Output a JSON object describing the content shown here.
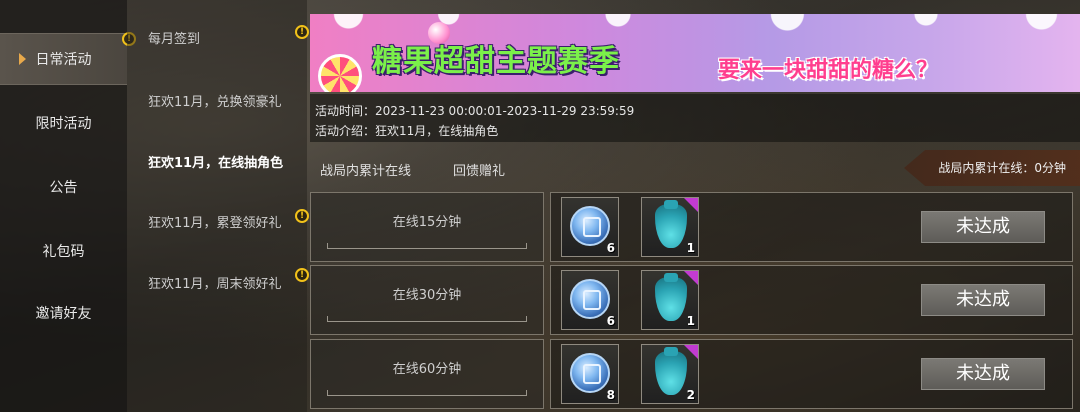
{
  "nav": {
    "items": [
      {
        "label": "日常活动",
        "active": true
      },
      {
        "label": "限时活动",
        "active": false
      },
      {
        "label": "公告",
        "active": false
      },
      {
        "label": "礼包码",
        "active": false
      },
      {
        "label": "邀请好友",
        "active": false
      }
    ]
  },
  "sublist": {
    "items": [
      {
        "label": "每月签到",
        "active": false,
        "alert": true
      },
      {
        "label": "狂欢11月，兑换领豪礼",
        "active": false,
        "alert": false
      },
      {
        "label": "狂欢11月，在线抽角色",
        "active": true,
        "alert": false
      },
      {
        "label": "狂欢11月，累登领好礼",
        "active": false,
        "alert": true
      },
      {
        "label": "狂欢11月，周末领好礼",
        "active": false,
        "alert": true
      }
    ],
    "alert_glyph": "!"
  },
  "banner": {
    "title_left": "糖果超甜主题赛季",
    "title_right": "要来一块甜甜的糖么？"
  },
  "info": {
    "time": "活动时间：2023-11-23 00:00:01-2023-11-29 23:59:59",
    "intro": "活动介绍：狂欢11月，在线抽角色"
  },
  "tabs": [
    {
      "label": "战局内累计在线"
    },
    {
      "label": "回馈赠礼"
    }
  ],
  "online_badge": "战局内累计在线：0分钟",
  "rewards": [
    {
      "label": "在线15分钟",
      "items": [
        {
          "icon": "coin-icon",
          "count": "6"
        },
        {
          "icon": "bag-icon",
          "count": "1"
        }
      ],
      "status": "未达成"
    },
    {
      "label": "在线30分钟",
      "items": [
        {
          "icon": "coin-icon",
          "count": "6"
        },
        {
          "icon": "bag-icon",
          "count": "1"
        }
      ],
      "status": "未达成"
    },
    {
      "label": "在线60分钟",
      "items": [
        {
          "icon": "coin-icon",
          "count": "8"
        },
        {
          "icon": "bag-icon",
          "count": "2"
        }
      ],
      "status": "未达成"
    }
  ],
  "colors": {
    "alert": "#f2c21a",
    "nav_arrow": "#e8a94b",
    "rarity_corner": "#c23bd1"
  }
}
